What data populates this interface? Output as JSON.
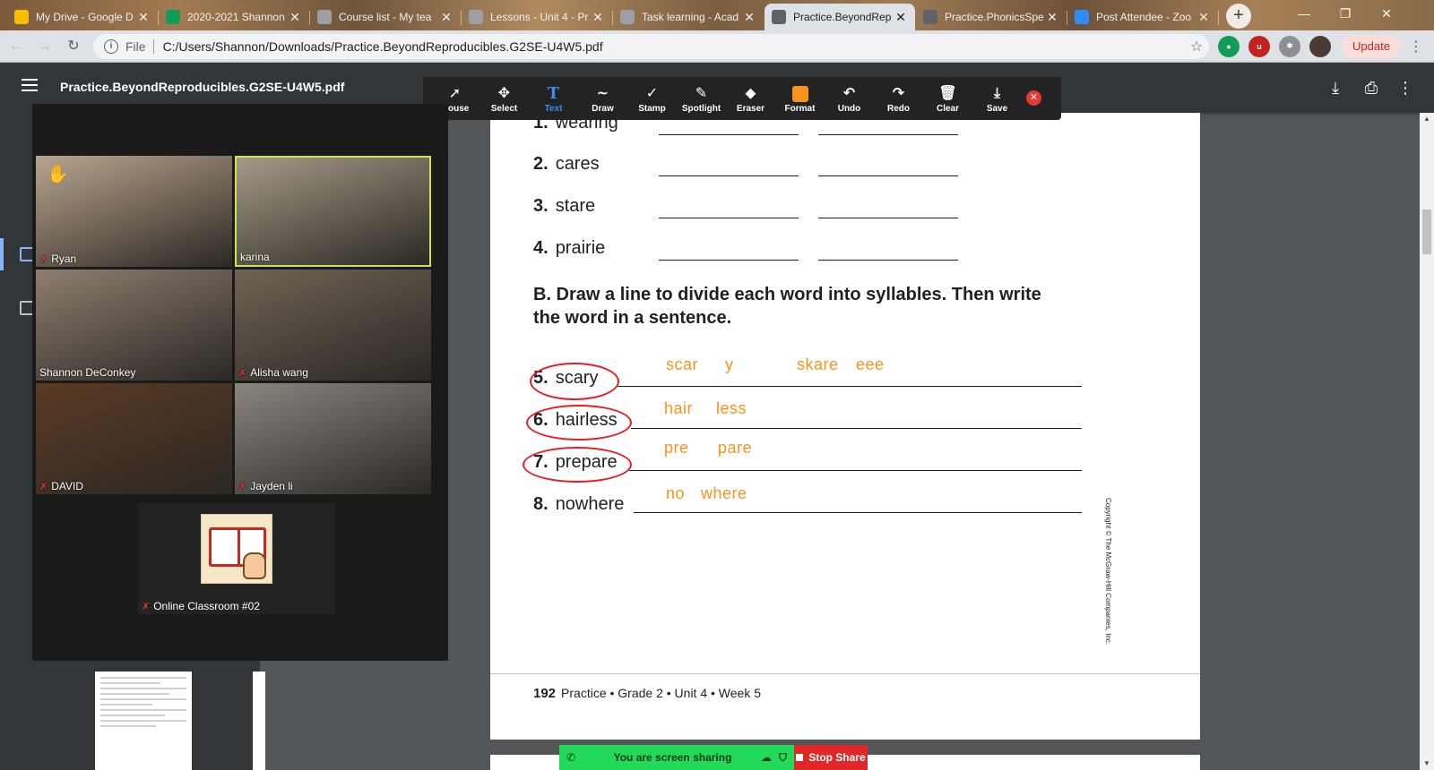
{
  "tabs": [
    {
      "title": "My Drive - Google D",
      "icon": "google-drive-icon",
      "color": "#fbbc04"
    },
    {
      "title": "2020-2021 Shannon",
      "icon": "google-sheets-icon",
      "color": "#0f9d58"
    },
    {
      "title": "Course list - My tea",
      "icon": "document-icon",
      "color": "#9aa0a6"
    },
    {
      "title": "Lessons - Unit 4 - Pr",
      "icon": "document-icon",
      "color": "#9aa0a6"
    },
    {
      "title": "Task learning - Acad",
      "icon": "document-icon",
      "color": "#9aa0a6"
    },
    {
      "title": "Practice.BeyondRep",
      "icon": "globe-icon",
      "color": "#5f6368"
    },
    {
      "title": "Practice.PhonicsSpe",
      "icon": "globe-icon",
      "color": "#5f6368"
    },
    {
      "title": "Post Attendee - Zoo",
      "icon": "zoom-icon",
      "color": "#2d8cff"
    }
  ],
  "address": {
    "scheme": "File",
    "url": "C:/Users/Shannon/Downloads/Practice.BeyondReproducibles.G2SE-U4W5.pdf",
    "update_label": "Update"
  },
  "pdf": {
    "filename": "Practice.BeyondReproducibles.G2SE-U4W5.pdf"
  },
  "annotation_tools": [
    {
      "label": "Mouse",
      "icon": "cursor-icon",
      "glyph": "➚"
    },
    {
      "label": "Select",
      "icon": "move-icon",
      "glyph": "✥"
    },
    {
      "label": "Text",
      "icon": "text-icon",
      "glyph": "T"
    },
    {
      "label": "Draw",
      "icon": "draw-icon",
      "glyph": "∼"
    },
    {
      "label": "Stamp",
      "icon": "checkmark-icon",
      "glyph": "✓"
    },
    {
      "label": "Spotlight",
      "icon": "spotlight-icon",
      "glyph": "✎"
    },
    {
      "label": "Eraser",
      "icon": "eraser-icon",
      "glyph": "⬥"
    },
    {
      "label": "Format",
      "icon": "format-icon",
      "glyph": ""
    },
    {
      "label": "Undo",
      "icon": "undo-icon",
      "glyph": "↶"
    },
    {
      "label": "Redo",
      "icon": "redo-icon",
      "glyph": "↷"
    },
    {
      "label": "Clear",
      "icon": "trash-icon",
      "glyph": "🗑"
    },
    {
      "label": "Save",
      "icon": "save-icon",
      "glyph": "⤓"
    }
  ],
  "worksheet": {
    "part_a": [
      {
        "num": "1.",
        "word": "wearing"
      },
      {
        "num": "2.",
        "word": "cares"
      },
      {
        "num": "3.",
        "word": "stare"
      },
      {
        "num": "4.",
        "word": "prairie"
      }
    ],
    "instruction": "B. Draw a line to divide each word into syllables. Then write the word in a sentence.",
    "part_b": [
      {
        "num": "5.",
        "word": "scary",
        "handwriting": [
          "scar",
          "y",
          "skare",
          "eee"
        ]
      },
      {
        "num": "6.",
        "word": "hairless",
        "handwriting": [
          "hair",
          "less"
        ]
      },
      {
        "num": "7.",
        "word": "prepare",
        "handwriting": [
          "pre",
          "pare"
        ]
      },
      {
        "num": "8.",
        "word": "nowhere",
        "handwriting": [
          "no",
          "where"
        ]
      }
    ],
    "footer_page": "192",
    "footer_text": "Practice • Grade 2 • Unit 4 • Week 5",
    "copyright": "Copyright © The McGraw-Hill Companies, Inc.",
    "handwriting_color": "#f7931e",
    "circle_color": "#e31e24"
  },
  "participants": [
    {
      "name": "Ryan",
      "muted": true,
      "hand_raised": true,
      "bg": "#b9a58e"
    },
    {
      "name": "karina",
      "muted": false,
      "hand_raised": false,
      "bg": "#a49a87",
      "active_speaker": true
    },
    {
      "name": "Shannon DeConkey",
      "muted": false,
      "hand_raised": false,
      "bg": "#8d7e70"
    },
    {
      "name": "Alisha wang",
      "muted": true,
      "hand_raised": false,
      "bg": "#6f6355"
    },
    {
      "name": "DAVID",
      "muted": true,
      "hand_raised": false,
      "bg": "#5a3a24"
    },
    {
      "name": "Jayden li",
      "muted": true,
      "hand_raised": false,
      "bg": "#8b8580"
    },
    {
      "name": "Online Classroom #02",
      "muted": true,
      "hand_raised": false
    }
  ],
  "share": {
    "status": "You are screen sharing",
    "stop_label": "Stop Share"
  }
}
